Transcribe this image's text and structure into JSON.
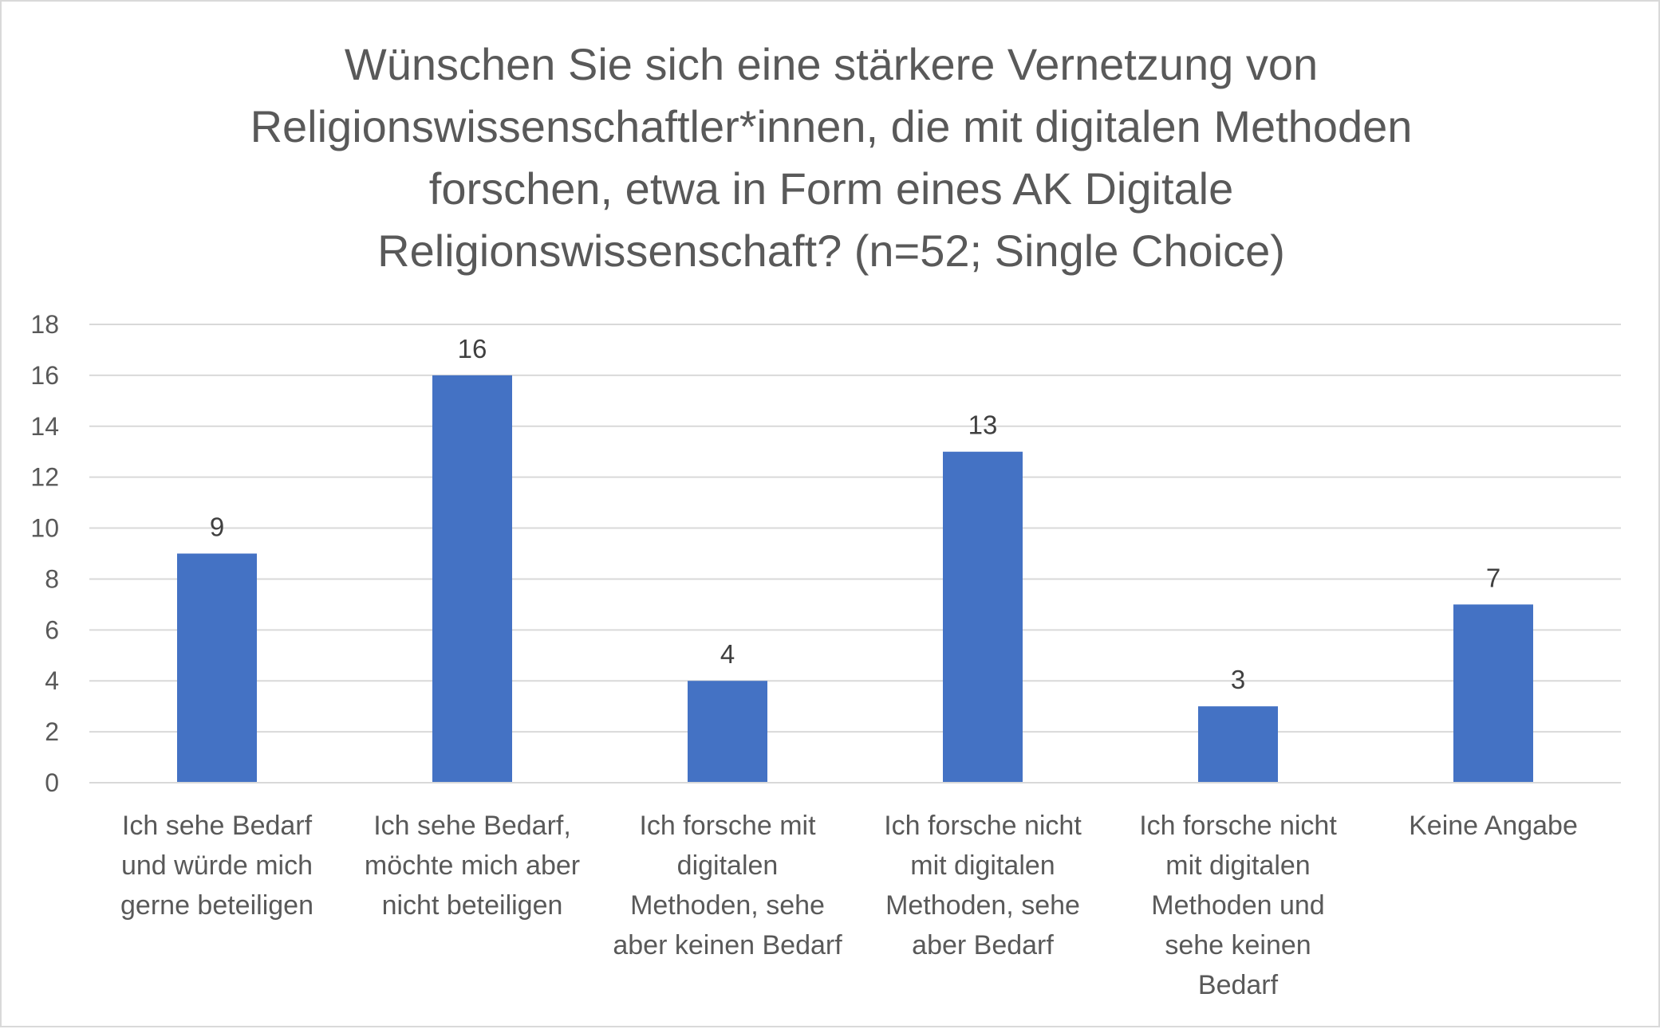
{
  "chart_data": {
    "type": "bar",
    "title": "Wünschen Sie sich eine stärkere Vernetzung von\nReligionswissenschaftler*innen, die mit digitalen Methoden\nforschen, etwa in Form eines AK Digitale\nReligionswissenschaft? (n=52; Single Choice)",
    "categories": [
      [
        "Ich sehe Bedarf",
        "und würde mich",
        "gerne beteiligen"
      ],
      [
        "Ich sehe Bedarf,",
        "möchte mich aber",
        "nicht beteiligen"
      ],
      [
        "Ich forsche mit",
        "digitalen",
        "Methoden, sehe",
        "aber keinen Bedarf"
      ],
      [
        "Ich forsche nicht",
        "mit digitalen",
        "Methoden, sehe",
        "aber Bedarf"
      ],
      [
        "Ich forsche nicht",
        "mit digitalen",
        "Methoden und",
        "sehe keinen",
        "Bedarf"
      ],
      [
        "Keine Angabe"
      ]
    ],
    "values": [
      9,
      16,
      4,
      13,
      3,
      7
    ],
    "data_labels": [
      "9",
      "16",
      "4",
      "13",
      "3",
      "7"
    ],
    "ylim": [
      0,
      18
    ],
    "yticks": [
      "0",
      "2",
      "4",
      "6",
      "8",
      "10",
      "12",
      "14",
      "16",
      "18"
    ],
    "grid": true,
    "legend": "none",
    "xlabel": "",
    "ylabel": "",
    "colors": {
      "bar": "#4472c4",
      "grid": "#d9d9d9",
      "text": "#595959"
    }
  }
}
